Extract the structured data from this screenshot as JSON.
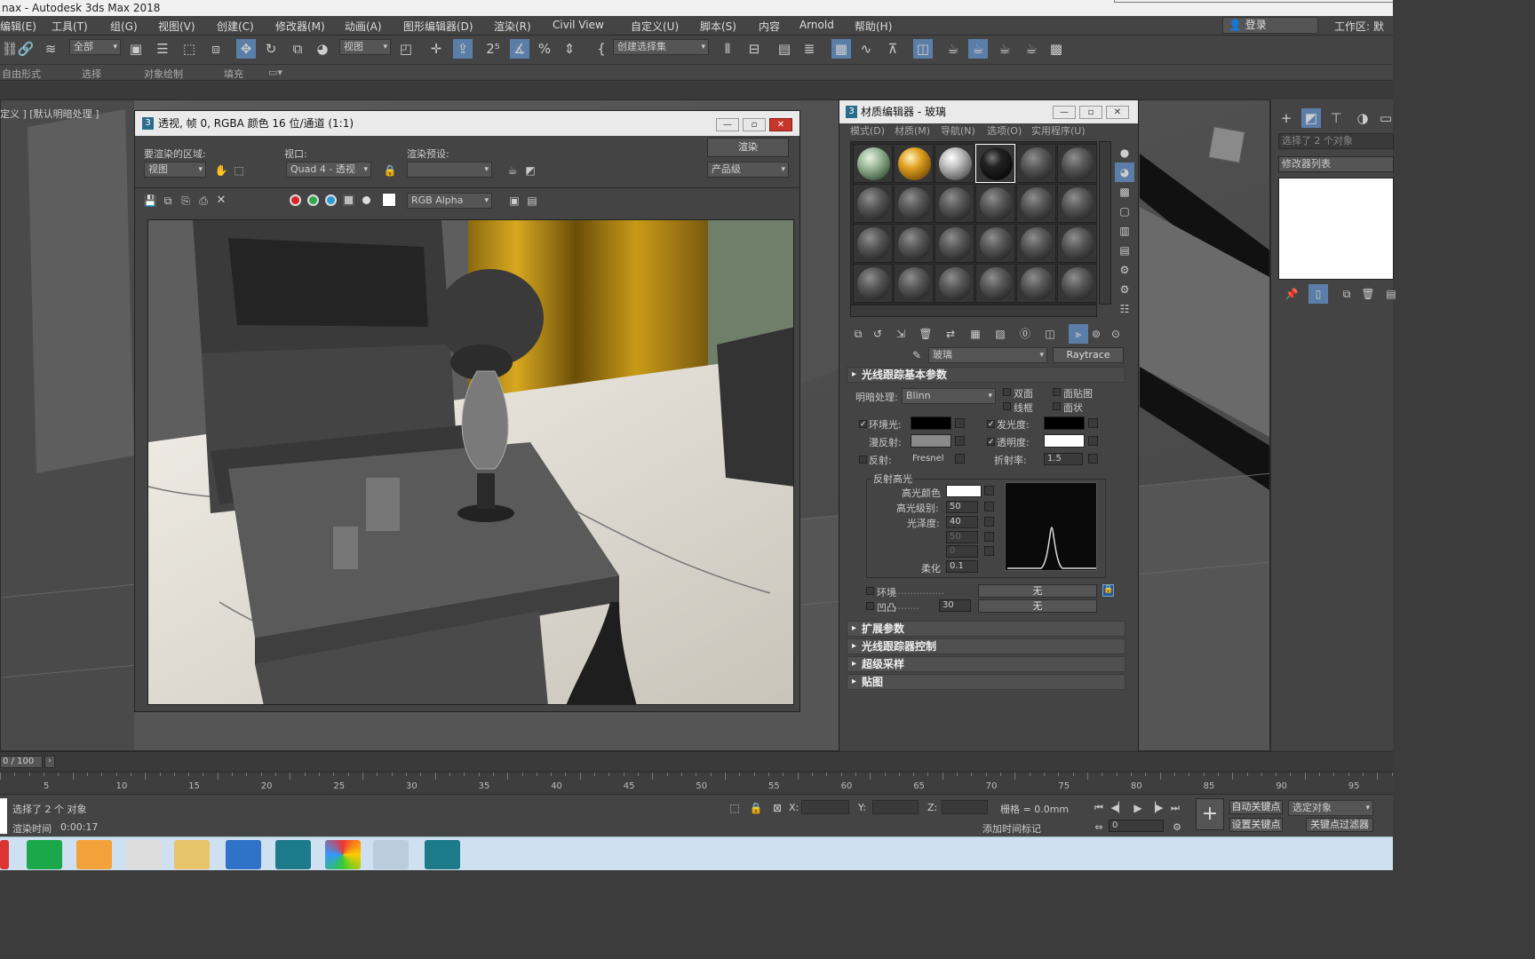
{
  "app": {
    "title": "nax - Autodesk 3ds Max 2018"
  },
  "menu": {
    "items": [
      "编辑(E)",
      "工具(T)",
      "组(G)",
      "视图(V)",
      "创建(C)",
      "修改器(M)",
      "动画(A)",
      "图形编辑器(D)",
      "渲染(R)",
      "Civil View",
      "自定义(U)",
      "脚本(S)",
      "内容",
      "Arnold",
      "帮助(H)"
    ],
    "login": "登录",
    "workspace": "工作区:",
    "workspace_value": "默认"
  },
  "toolbar": {
    "filter": "全部",
    "refcoord": "视图",
    "selset": "创建选择集"
  },
  "ribbon": {
    "tabs": [
      "自由形式",
      "选择",
      "对象绘制",
      "填充"
    ]
  },
  "viewport": {
    "label": "定义 ] [默认明暗处理 ]"
  },
  "render_window": {
    "title": "透视, 帧 0, RGBA 颜色 16 位/通道 (1:1)",
    "area_label": "要渲染的区域:",
    "area_value": "视图",
    "viewport_label": "视口:",
    "viewport_value": "Quad 4 - 透视",
    "preset_label": "渲染预设:",
    "preset_value": "",
    "render_button": "渲染",
    "quality_value": "产品级",
    "channel_value": "RGB Alpha"
  },
  "material_editor": {
    "title": "材质编辑器 - 玻璃",
    "menu": [
      "模式(D)",
      "材质(M)",
      "导航(N)",
      "选项(O)",
      "实用程序(U)"
    ],
    "material_name": "玻璃",
    "material_type": "Raytrace",
    "rollout_basic": "光线跟踪基本参数",
    "shading_label": "明暗处理:",
    "shading_value": "Blinn",
    "two_sided": "双面",
    "wire": "线框",
    "face_map": "面贴图",
    "faceted": "面状",
    "ambient": "环境光:",
    "diffuse": "漫反射:",
    "reflect": "反射:",
    "reflect_value": "Fresnel",
    "luminosity": "发光度:",
    "transparency": "透明度:",
    "ior_label": "折射率:",
    "ior_value": "1.5",
    "spec_group": "反射高光",
    "spec_color": "高光颜色",
    "spec_level_label": "高光级别:",
    "spec_level": "50",
    "gloss_label": "光泽度:",
    "gloss": "40",
    "aniso": "50",
    "orient": "0",
    "soften_label": "柔化",
    "soften": "0.1",
    "env_label": "环境",
    "env_value": "无",
    "bump_label": "凹凸",
    "bump_amount": "30",
    "bump_value": "无",
    "rollouts": [
      "扩展参数",
      "光线跟踪器控制",
      "超级采样",
      "贴图"
    ]
  },
  "right_panel": {
    "selected": "选择了 2 个对象",
    "modifier_list": "修改器列表"
  },
  "timeline": {
    "frame": "0 / 100",
    "ticks": [
      "5",
      "10",
      "15",
      "20",
      "25",
      "30",
      "35",
      "40",
      "45",
      "50",
      "55",
      "60",
      "65",
      "70",
      "75",
      "80",
      "85",
      "90",
      "95"
    ]
  },
  "status": {
    "selected": "选择了 2 个 对象",
    "render_time_label": "渲染时间",
    "render_time": "0:00:17",
    "x_label": "X:",
    "y_label": "Y:",
    "z_label": "Z:",
    "grid": "栅格 = 0.0mm",
    "add_time_tag": "添加时间标记",
    "auto_key": "自动关键点",
    "set_key": "设置关键点",
    "sel_obj": "选定对象",
    "key_filter": "关键点过滤器",
    "frame_value": "0"
  }
}
